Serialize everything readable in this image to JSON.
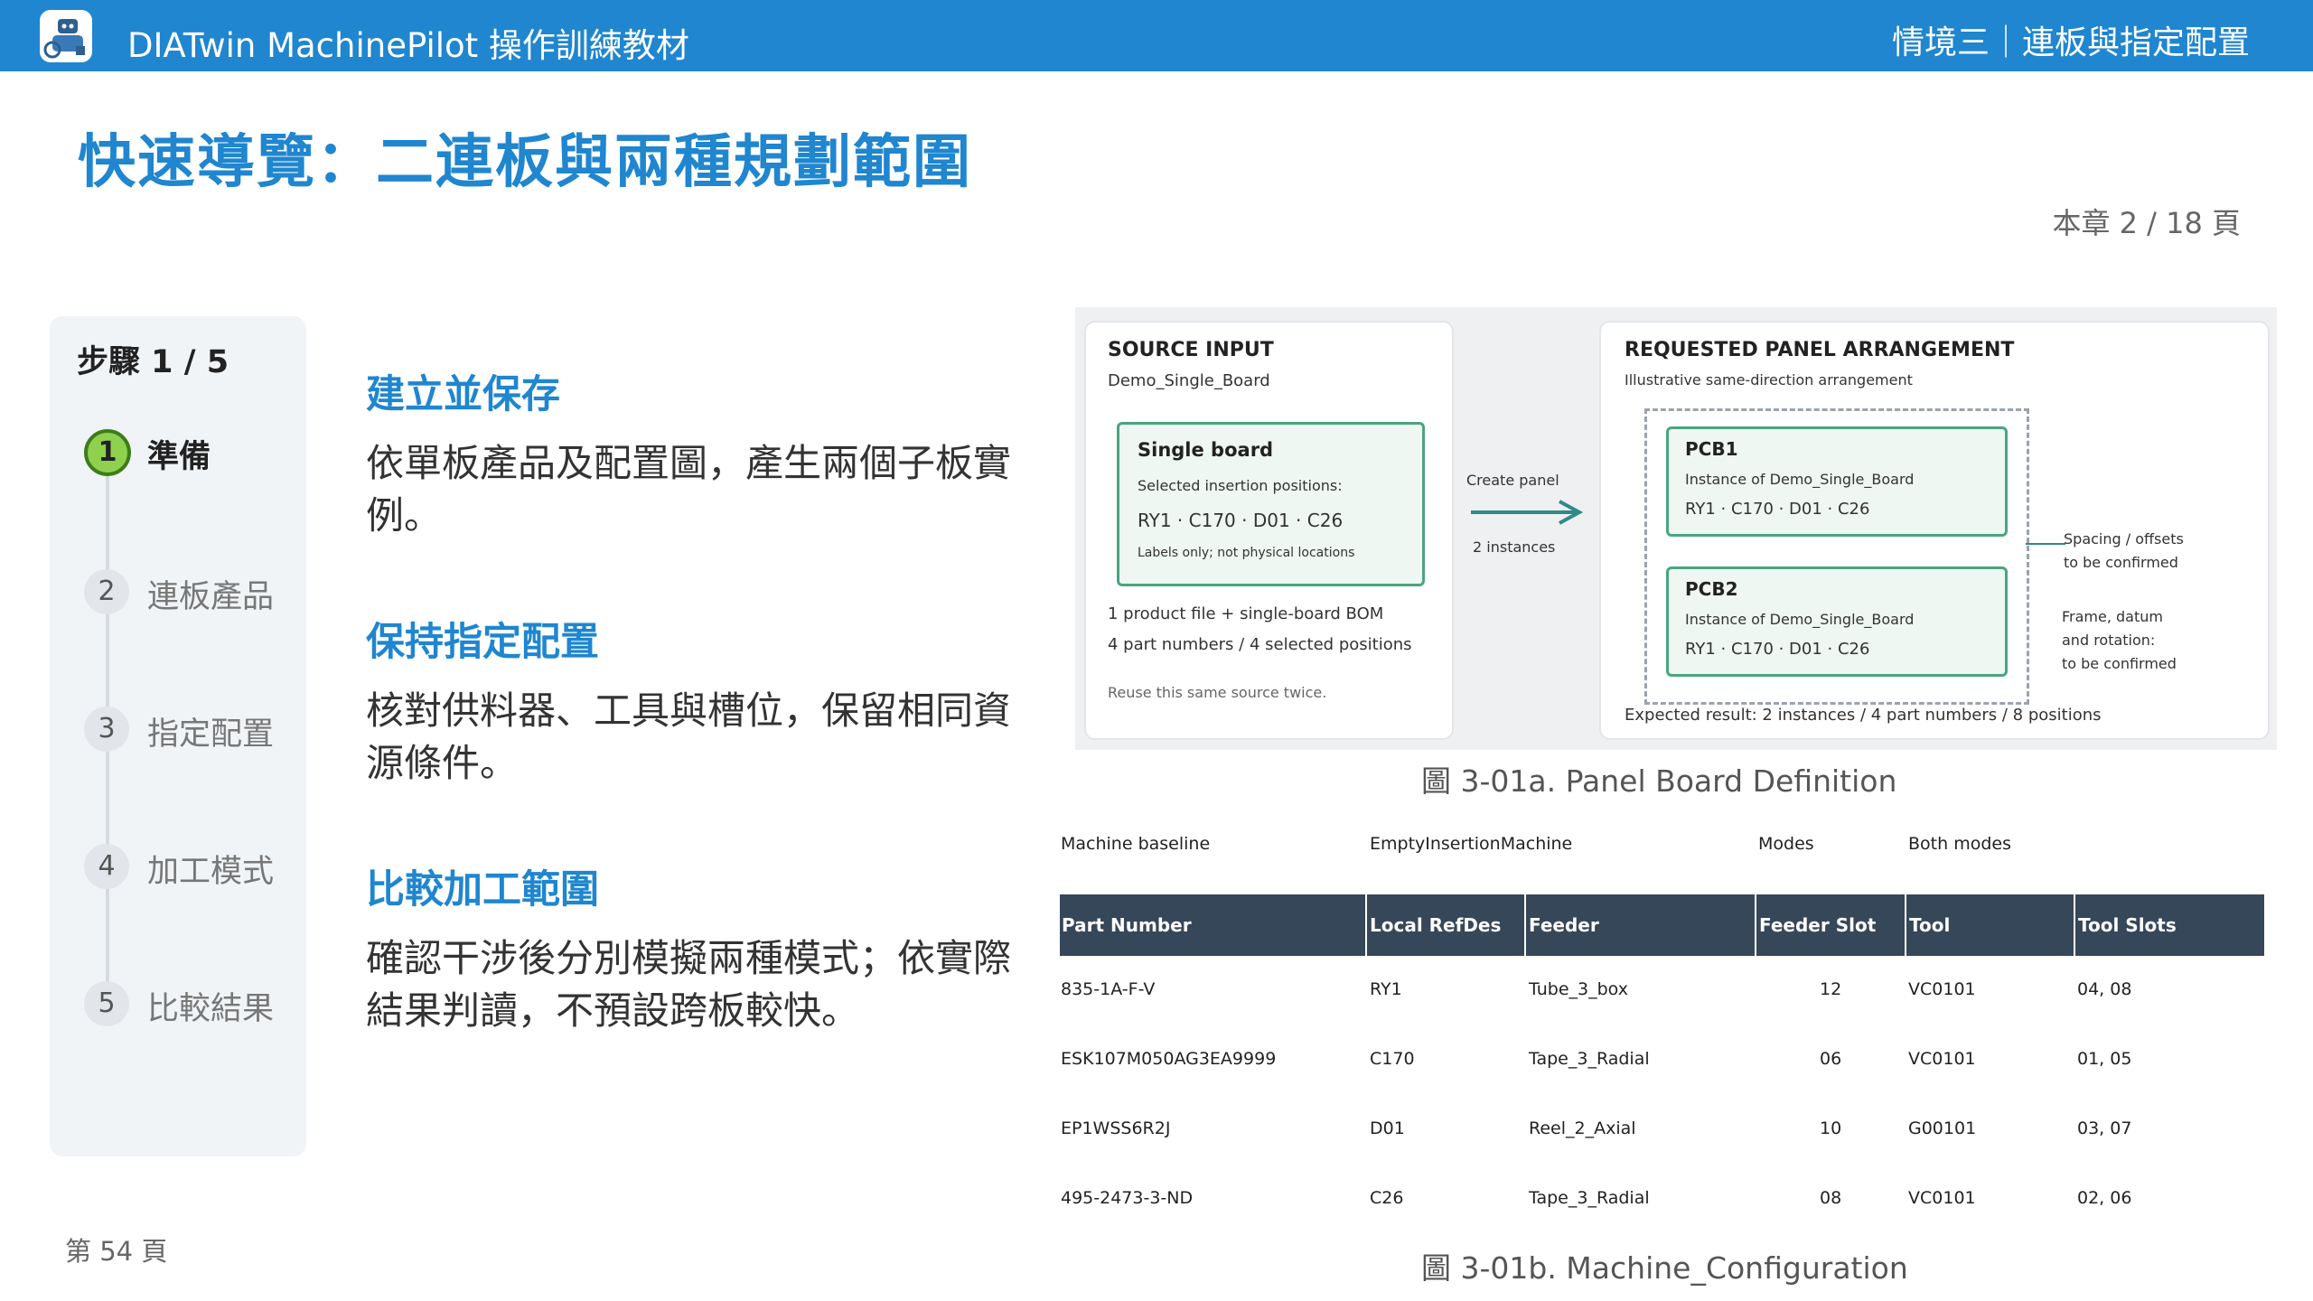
{
  "topbar": {
    "app_title": "DIATwin MachinePilot 操作訓練教材",
    "section_title": "情境三｜連板與指定配置",
    "logo_icon": "robot-logo-icon"
  },
  "heading": "快速導覽：二連板與兩種規劃範圍",
  "chapter_page": "本章 2 / 18 頁",
  "steps": {
    "title": "步驟 1 / 5",
    "items": [
      {
        "num": "1",
        "label": "準備"
      },
      {
        "num": "2",
        "label": "連板產品"
      },
      {
        "num": "3",
        "label": "指定配置"
      },
      {
        "num": "4",
        "label": "加工模式"
      },
      {
        "num": "5",
        "label": "比較結果"
      }
    ]
  },
  "blocks": [
    {
      "title": "建立並保存",
      "text": "依單板產品及配置圖，產生兩個子板實例。"
    },
    {
      "title": "保持指定配置",
      "text": "核對供料器、工具與槽位，保留相同資源條件。"
    },
    {
      "title": "比較加工範圍",
      "text": "確認干涉後分別模擬兩種模式；依實際結果判讀，不預設跨板較快。"
    }
  ],
  "figure_a": {
    "source": {
      "title": "SOURCE INPUT",
      "subtitle": "Demo_Single_Board",
      "board_title": "Single board",
      "board_sub": "Selected insertion positions:",
      "board_refs": "RY1 · C170 · D01 · C26",
      "board_note": "Labels only; not physical locations",
      "line1": "1 product file + single-board BOM",
      "line2": "4 part numbers / 4 selected positions",
      "line3": "Reuse this same source twice."
    },
    "arrow": {
      "top": "Create panel",
      "bottom": "2 instances"
    },
    "requested": {
      "title": "REQUESTED PANEL ARRANGEMENT",
      "subtitle": "Illustrative same-direction arrangement",
      "pcb1_title": "PCB1",
      "pcb1_sub": "Instance of Demo_Single_Board",
      "pcb1_refs": "RY1 · C170 · D01 · C26",
      "pcb2_title": "PCB2",
      "pcb2_sub": "Instance of Demo_Single_Board",
      "pcb2_refs": "RY1 · C170 · D01 · C26",
      "note1a": "Spacing / offsets",
      "note1b": "to be confirmed",
      "note2a": "Frame, datum",
      "note2b": "and rotation:",
      "note2c": "to be confirmed",
      "result": "Expected result: 2 instances / 4 part numbers / 8 positions"
    },
    "caption": "圖 3-01a. Panel Board Definition"
  },
  "figure_b": {
    "meta": {
      "label1": "Machine baseline",
      "value1": "EmptyInsertionMachine",
      "label2": "Modes",
      "value2": "Both modes"
    },
    "columns": [
      "Part Number",
      "Local RefDes",
      "Feeder",
      "Feeder Slot",
      "Tool",
      "Tool Slots"
    ],
    "rows": [
      [
        "835-1A-F-V",
        "RY1",
        "Tube_3_box",
        "12",
        "VC0101",
        "04, 08"
      ],
      [
        "ESK107M050AG3EA9999",
        "C170",
        "Tape_3_Radial",
        "06",
        "VC0101",
        "01, 05"
      ],
      [
        "EP1WSS6R2J",
        "D01",
        "Reel_2_Axial",
        "10",
        "G00101",
        "03, 07"
      ],
      [
        "495-2473-3-ND",
        "C26",
        "Tape_3_Radial",
        "08",
        "VC0101",
        "02, 06"
      ]
    ],
    "caption": "圖 3-01b. Machine_Configuration"
  },
  "footer_page": "第 54 頁",
  "colors": {
    "accent": "#1f86cf",
    "header_bg": "#37475a",
    "green": "#4aa57f",
    "step_active": "#8fd14f"
  }
}
